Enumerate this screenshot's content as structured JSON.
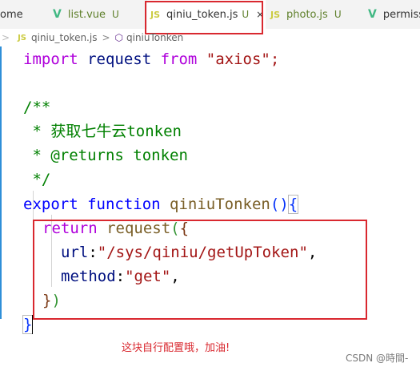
{
  "tabs": [
    {
      "label": "ome",
      "icon": "",
      "status": "",
      "active": false
    },
    {
      "label": "list.vue",
      "icon": "V",
      "status": "U",
      "active": false
    },
    {
      "label": "qiniu_token.js",
      "icon": "JS",
      "status": "U",
      "active": true,
      "close": "×"
    },
    {
      "label": "photo.js",
      "icon": "JS",
      "status": "U",
      "active": false
    },
    {
      "label": "permiss",
      "icon": "V",
      "status": "",
      "active": false
    }
  ],
  "breadcrumb": {
    "file_icon": "JS",
    "file": "qiniu_token.js",
    "separator": ">",
    "symbol": "qiniuTonken"
  },
  "code": {
    "line1": [
      "import",
      " request ",
      "from",
      " \"axios\";"
    ],
    "line3": "/**",
    "line4": " * 获取七牛云tonken",
    "line5": " * @returns tonken",
    "line6": " */",
    "line7": [
      "export",
      " function ",
      "qiniuTonken",
      "(",
      ")",
      "{"
    ],
    "line8": [
      "return",
      " ",
      "request",
      "(",
      "{"
    ],
    "line9": [
      "url",
      ":",
      "\"/sys/qiniu/getUpToken\"",
      ","
    ],
    "line10": [
      "method",
      ":",
      "\"get\"",
      ","
    ],
    "line11": [
      "}",
      ")"
    ],
    "line12": "}"
  },
  "annotation": "这块自行配置哦，加油!",
  "watermark": "CSDN @時間-"
}
